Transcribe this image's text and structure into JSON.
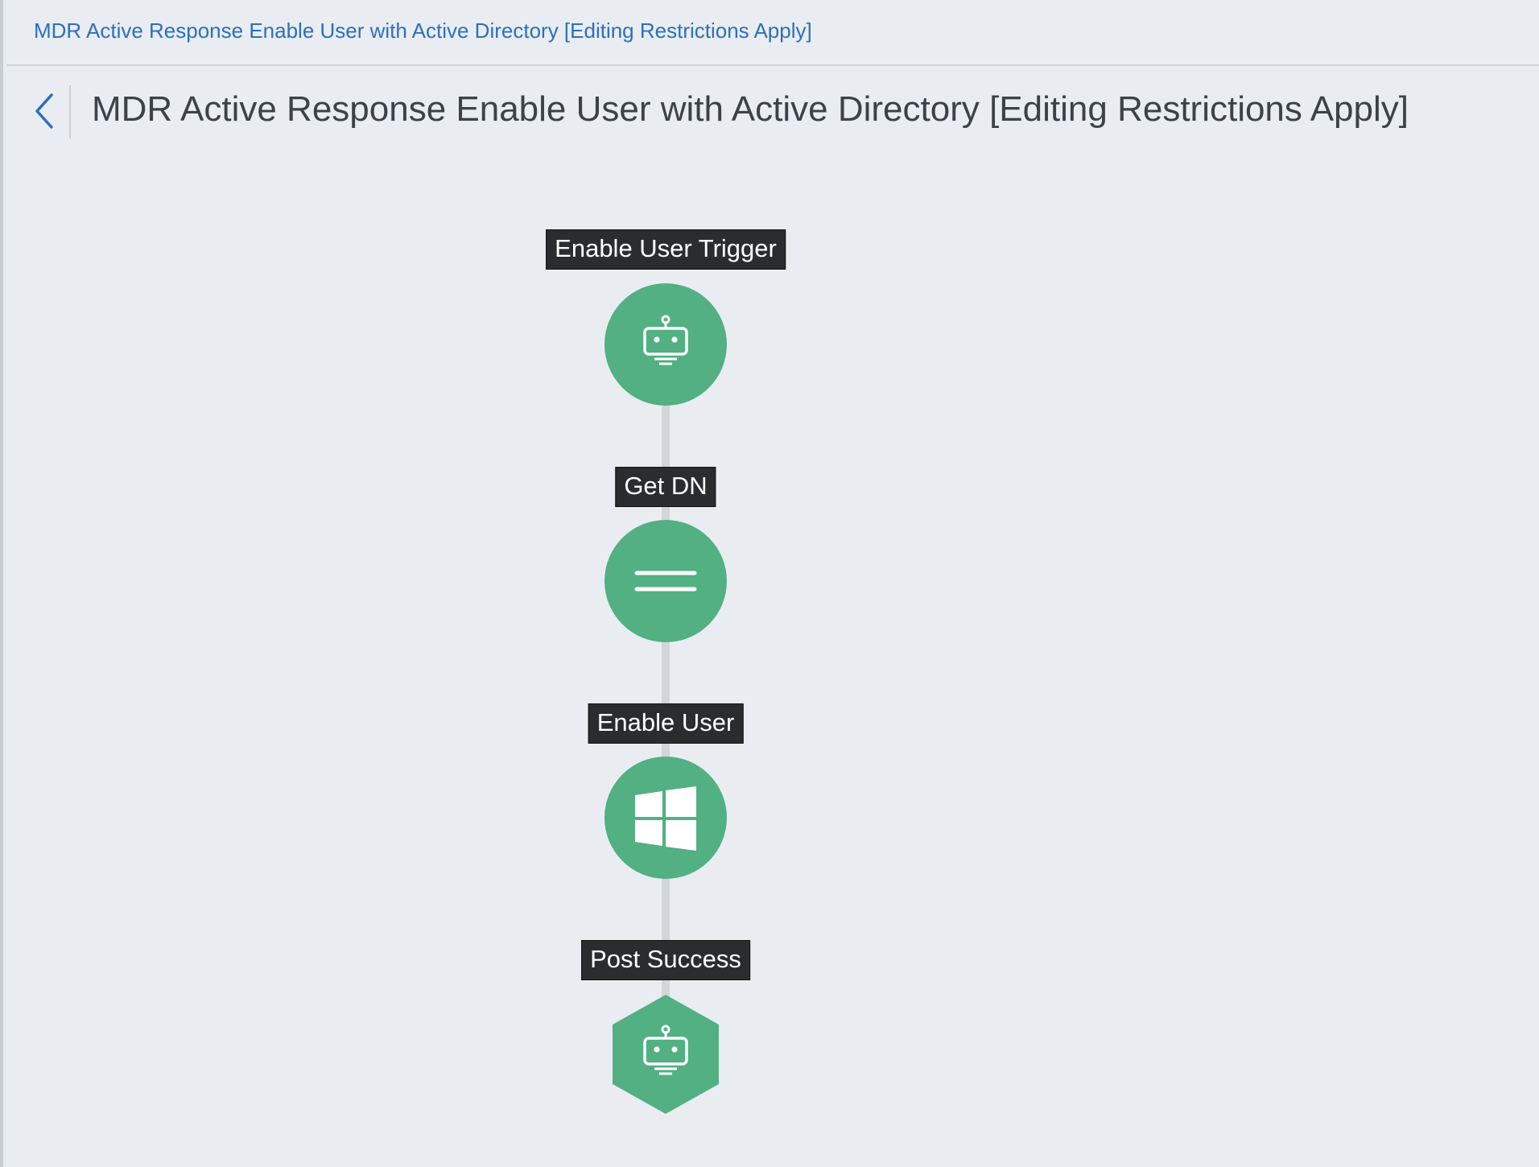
{
  "breadcrumb": {
    "link_text": "MDR Active Response Enable User with Active Directory [Editing Restrictions Apply]"
  },
  "header": {
    "title": "MDR Active Response Enable User with Active Directory [Editing Restrictions Apply]",
    "back_icon": "chevron-left-icon"
  },
  "workflow": {
    "nodes": [
      {
        "label": "Enable User Trigger",
        "icon": "robot-icon",
        "shape": "circle"
      },
      {
        "label": "Get DN",
        "icon": "equals-icon",
        "shape": "circle"
      },
      {
        "label": "Enable User",
        "icon": "windows-icon",
        "shape": "circle"
      },
      {
        "label": "Post Success",
        "icon": "robot-icon",
        "shape": "hexagon"
      }
    ]
  },
  "colors": {
    "background": "#e9edf1",
    "node_fill": "#52b083",
    "label_bg": "#2b2c2d",
    "link": "#2d6fbd",
    "connector": "#d3d6d9"
  }
}
